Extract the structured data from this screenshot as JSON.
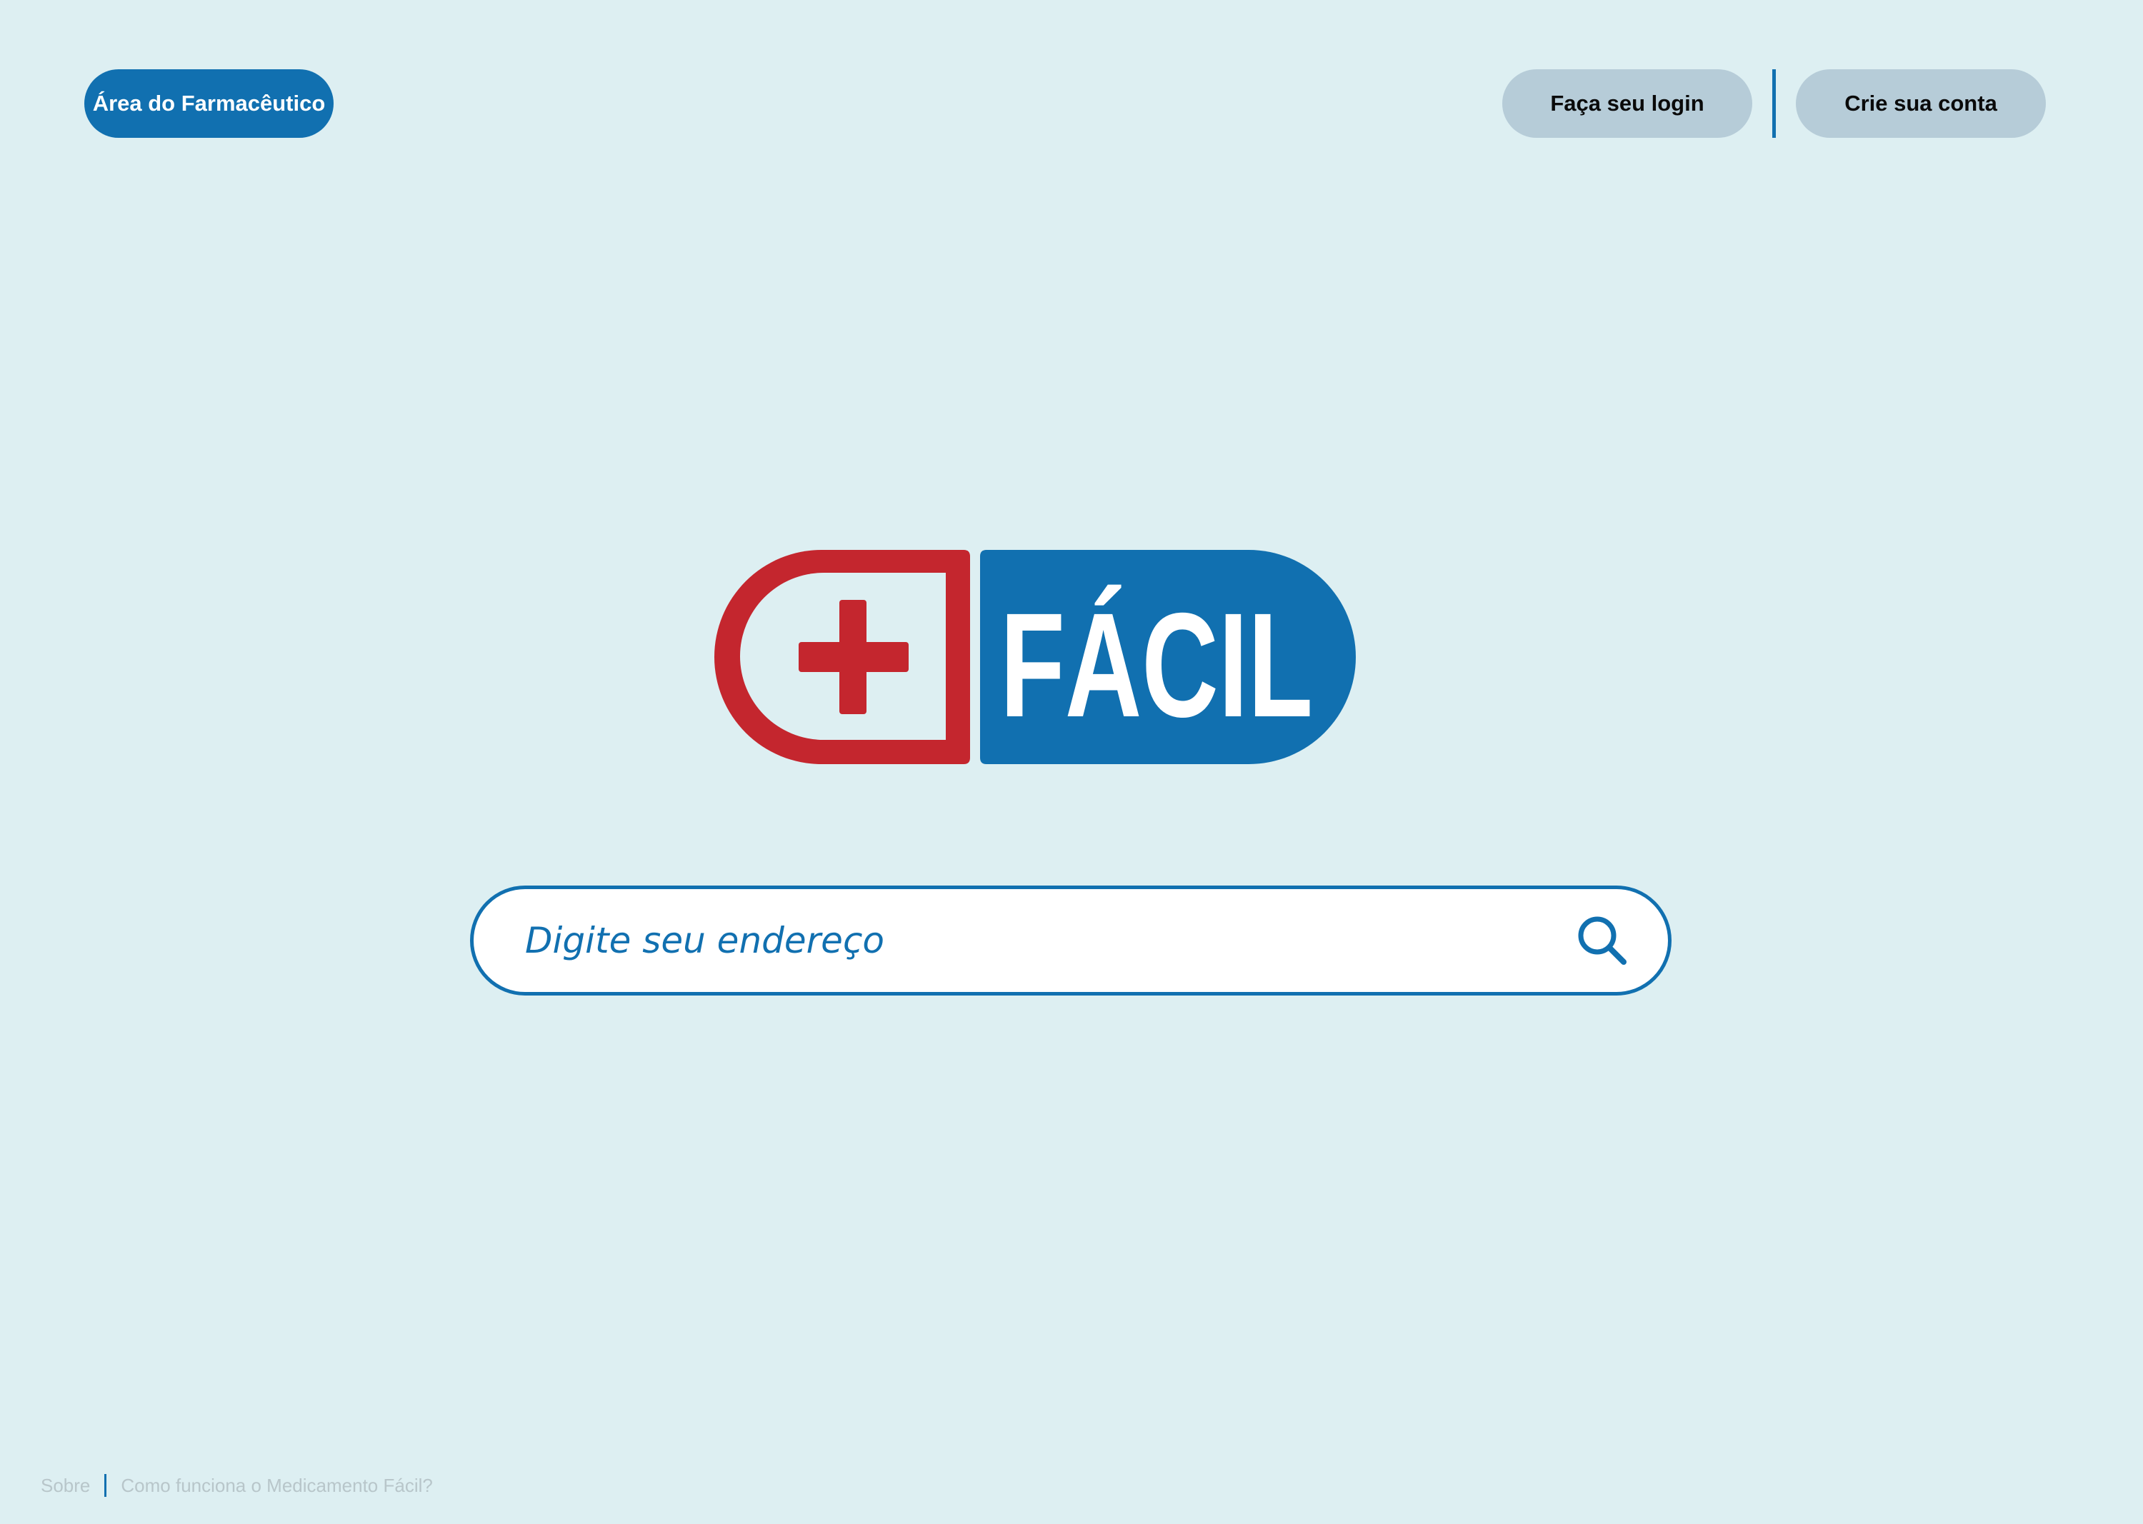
{
  "header": {
    "pharmacist_area_label": "Área do Farmacêutico",
    "login_label": "Faça seu login",
    "signup_label": "Crie sua conta"
  },
  "logo": {
    "text": "FÁCIL",
    "colors": {
      "red": "#c4262e",
      "blue": "#1170b0"
    }
  },
  "search": {
    "placeholder": "Digite seu endereço",
    "icon": "search-icon"
  },
  "footer": {
    "links": [
      "Sobre",
      "Como funciona o Medicamento Fácil?"
    ]
  },
  "colors": {
    "background": "#ddeff2",
    "accent": "#1170b0",
    "secondary_button": "#b6ccd8",
    "footer_text": "#b8c6ca"
  }
}
